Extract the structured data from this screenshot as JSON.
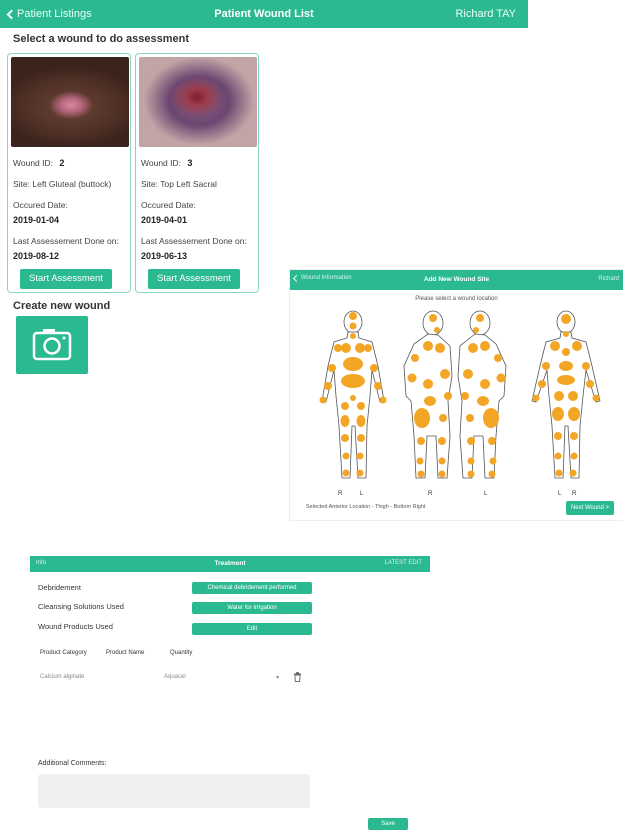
{
  "colors": {
    "accent": "#2bb991",
    "body_marker": "#f3a626"
  },
  "screen1": {
    "header": {
      "back_label": "Patient Listings",
      "title": "Patient Wound List",
      "user": "Richard TAY"
    },
    "section_title": "Select a wound to do assessment",
    "cards": [
      {
        "id_label": "Wound ID:",
        "id": "2",
        "site": "Site: Left Gluteal (buttock)",
        "date_label": "Occured Date:",
        "date": "2019-01-04",
        "last_label": "Last Assessement Done on:",
        "last": "2019-08-12",
        "button": "Start Assessment"
      },
      {
        "id_label": "Wound ID:",
        "id": "3",
        "site": "Site: Top Left Sacral",
        "date_label": "Occured Date:",
        "date": "2019-04-01",
        "last_label": "Last Assessement Done on:",
        "last": "2019-06-13",
        "button": "Start Assessment"
      }
    ],
    "create_title": "Create new wound",
    "camera_icon": "camera-icon"
  },
  "screen2": {
    "header": {
      "back_label": "Wound Information",
      "title": "Add New Wound Site",
      "right": "Richard"
    },
    "prompt": "Please select a wound location",
    "side_labels": [
      "R",
      "L",
      "R",
      "L",
      "L",
      "R"
    ],
    "footer": "Selected Anterior Location - Thigh - Bottom Right",
    "next_button": "Next Wound >"
  },
  "screen3": {
    "header": {
      "back_label": "Info",
      "title": "Treatment",
      "user": "LATEST EDIT"
    },
    "rows": [
      {
        "label": "Debridement",
        "button": "Chemical debridement performed"
      },
      {
        "label": "Cleansing Solutions Used",
        "button": "Water for Irrigation"
      },
      {
        "label": "Wound Products Used",
        "button": "Edit"
      }
    ],
    "columns": [
      "Product Category",
      "Product Name",
      "Quantity"
    ],
    "product_row": {
      "category": "Calcium alginate",
      "name": "Aquacel"
    },
    "comments_label": "Additional Comments:",
    "save_button": "Save"
  }
}
